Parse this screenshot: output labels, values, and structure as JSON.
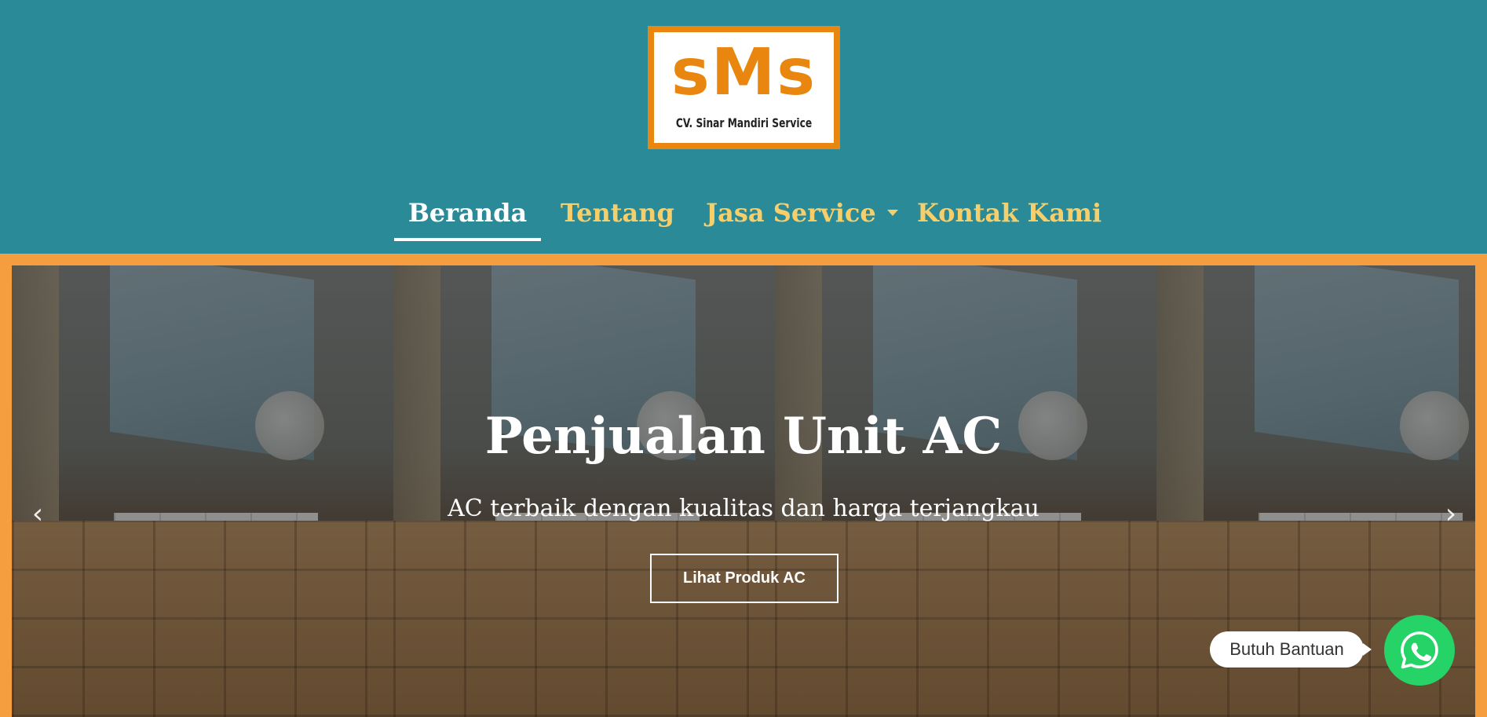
{
  "brand": {
    "logo_mark": "sMs",
    "logo_subtitle": "CV. Sinar Mandiri Service",
    "accent_color": "#e9860f",
    "header_color": "#2b8a98"
  },
  "nav": {
    "items": [
      {
        "label": "Beranda",
        "active": true
      },
      {
        "label": "Tentang",
        "active": false
      },
      {
        "label": "Jasa Service",
        "active": false,
        "has_dropdown": true
      },
      {
        "label": "Kontak Kami",
        "active": false
      }
    ],
    "active_color": "#ffffff",
    "link_color": "#f7cf6a"
  },
  "hero": {
    "title": "Penjualan Unit AC",
    "subtitle": "AC terbaik dengan kualitas dan harga terjangkau",
    "cta_label": "Lihat Produk AC",
    "prev_icon": "chevron-left-icon",
    "next_icon": "chevron-right-icon",
    "frame_color": "#f59e3f"
  },
  "help_widget": {
    "bubble_text": "Butuh Bantuan",
    "icon": "whatsapp-icon",
    "color": "#25d366"
  }
}
